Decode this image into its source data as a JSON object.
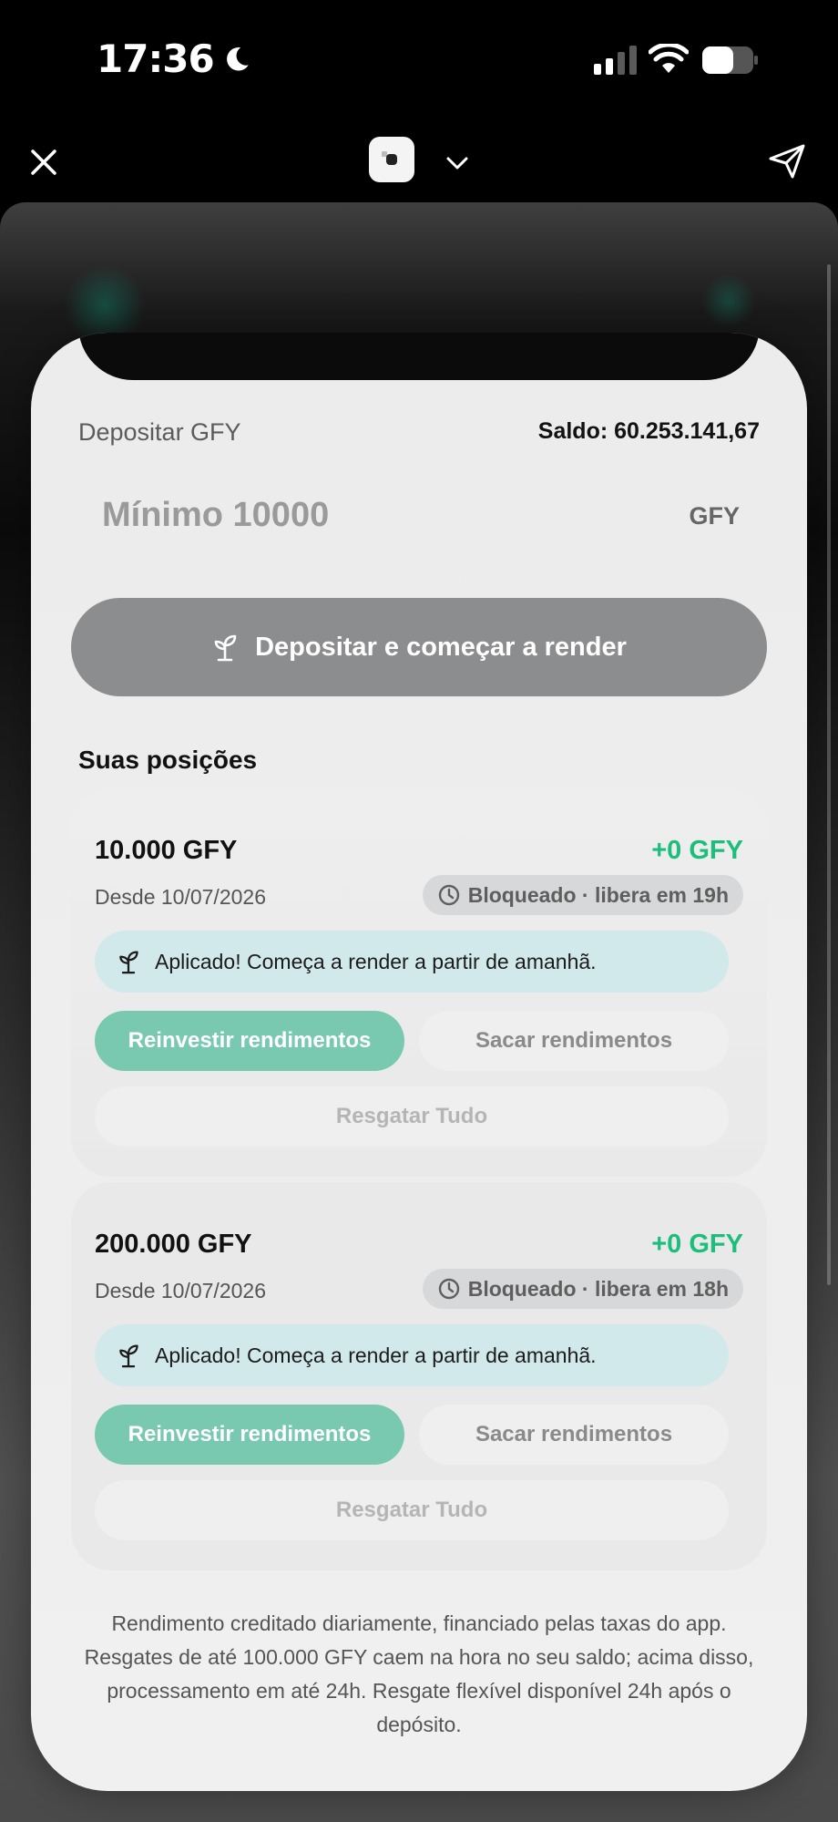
{
  "status_bar": {
    "time": "17:36"
  },
  "colors": {
    "accent_green": "#1dbd7c",
    "reinvest_button": "#79c8b0",
    "banner": "#d2e9ec",
    "deposit_button": "#8c8d8f"
  },
  "icons": [
    "moon-icon",
    "signal-icon",
    "wifi-icon",
    "battery-icon",
    "close-icon",
    "app-icon",
    "chevron-down-icon",
    "send-icon",
    "sprout-icon",
    "clock-icon"
  ],
  "deposit": {
    "label": "Depositar GFY",
    "balance": "Saldo: 60.253.141,67",
    "placeholder": "Mínimo 10000",
    "currency": "GFY",
    "button_label": "Depositar e começar a render"
  },
  "positions_title": "Suas posições",
  "positions": [
    {
      "amount": "10.000 GFY",
      "gain": "+0 GFY",
      "since": "Desde 10/07/2026",
      "lock_status": "Bloqueado · libera em 19h",
      "banner": "Aplicado! Começa a render a partir de amanhã.",
      "reinvest": "Reinvestir rendimentos",
      "withdraw": "Sacar rendimentos",
      "redeem_all": "Resgatar Tudo"
    },
    {
      "amount": "200.000 GFY",
      "gain": "+0 GFY",
      "since": "Desde 10/07/2026",
      "lock_status": "Bloqueado · libera em 18h",
      "banner": "Aplicado! Começa a render a partir de amanhã.",
      "reinvest": "Reinvestir rendimentos",
      "withdraw": "Sacar rendimentos",
      "redeem_all": "Resgatar Tudo"
    }
  ],
  "footnote": "Rendimento creditado diariamente, financiado pelas taxas do app. Resgates de até 100.000 GFY caem na hora no seu saldo; acima disso, processamento em até 24h. Resgate flexível disponível 24h após o depósito."
}
